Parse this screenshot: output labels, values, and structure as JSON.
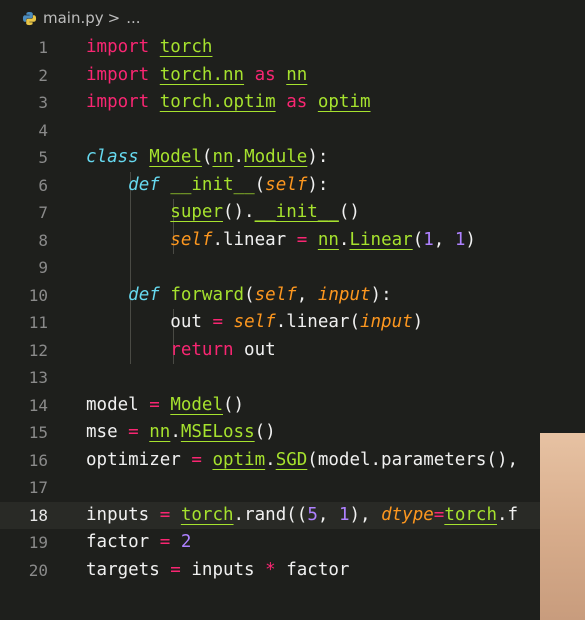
{
  "breadcrumb": {
    "file": "main.py",
    "separator": ">",
    "more": "..."
  },
  "lines": [
    {
      "num": "1",
      "tokens": [
        [
          "kw",
          "import"
        ],
        [
          "txt",
          " "
        ],
        [
          "name ul",
          "torch"
        ]
      ]
    },
    {
      "num": "2",
      "tokens": [
        [
          "kw",
          "import"
        ],
        [
          "txt",
          " "
        ],
        [
          "name ul",
          "torch.nn"
        ],
        [
          "txt",
          " "
        ],
        [
          "kw",
          "as"
        ],
        [
          "txt",
          " "
        ],
        [
          "name ul",
          "nn"
        ]
      ]
    },
    {
      "num": "3",
      "tokens": [
        [
          "kw",
          "import"
        ],
        [
          "txt",
          " "
        ],
        [
          "name ul",
          "torch.optim"
        ],
        [
          "txt",
          " "
        ],
        [
          "kw",
          "as"
        ],
        [
          "txt",
          " "
        ],
        [
          "name ul",
          "optim"
        ]
      ]
    },
    {
      "num": "4",
      "tokens": []
    },
    {
      "num": "5",
      "tokens": [
        [
          "cls",
          "class"
        ],
        [
          "txt",
          " "
        ],
        [
          "name ul",
          "Model"
        ],
        [
          "txt",
          "("
        ],
        [
          "name ul",
          "nn"
        ],
        [
          "txt",
          "."
        ],
        [
          "name ul",
          "Module"
        ],
        [
          "txt",
          "):"
        ]
      ]
    },
    {
      "num": "6",
      "guides": 1,
      "tokens": [
        [
          "txt",
          "    "
        ],
        [
          "cls",
          "def"
        ],
        [
          "txt",
          " "
        ],
        [
          "name",
          "__init__"
        ],
        [
          "txt",
          "("
        ],
        [
          "ital",
          "self"
        ],
        [
          "txt",
          "):"
        ]
      ]
    },
    {
      "num": "7",
      "guides": 2,
      "tokens": [
        [
          "txt",
          "        "
        ],
        [
          "name ul",
          "super"
        ],
        [
          "txt",
          "()."
        ],
        [
          "name ul",
          "__init__"
        ],
        [
          "txt",
          "()"
        ]
      ]
    },
    {
      "num": "8",
      "guides": 2,
      "tokens": [
        [
          "txt",
          "        "
        ],
        [
          "ital",
          "self"
        ],
        [
          "txt",
          ".linear "
        ],
        [
          "op",
          "="
        ],
        [
          "txt",
          " "
        ],
        [
          "name ul",
          "nn"
        ],
        [
          "txt",
          "."
        ],
        [
          "name ul",
          "Linear"
        ],
        [
          "txt",
          "("
        ],
        [
          "num",
          "1"
        ],
        [
          "txt",
          ", "
        ],
        [
          "num",
          "1"
        ],
        [
          "txt",
          ")"
        ]
      ]
    },
    {
      "num": "9",
      "guides": 1,
      "tokens": []
    },
    {
      "num": "10",
      "guides": 1,
      "tokens": [
        [
          "txt",
          "    "
        ],
        [
          "cls",
          "def"
        ],
        [
          "txt",
          " "
        ],
        [
          "name",
          "forward"
        ],
        [
          "txt",
          "("
        ],
        [
          "ital",
          "self"
        ],
        [
          "txt",
          ", "
        ],
        [
          "ital",
          "input"
        ],
        [
          "txt",
          "):"
        ]
      ]
    },
    {
      "num": "11",
      "guides": 2,
      "tokens": [
        [
          "txt",
          "        out "
        ],
        [
          "op",
          "="
        ],
        [
          "txt",
          " "
        ],
        [
          "ital",
          "self"
        ],
        [
          "txt",
          ".linear("
        ],
        [
          "ital",
          "input"
        ],
        [
          "txt",
          ")"
        ]
      ]
    },
    {
      "num": "12",
      "guides": 2,
      "tokens": [
        [
          "txt",
          "        "
        ],
        [
          "kw",
          "return"
        ],
        [
          "txt",
          " out"
        ]
      ]
    },
    {
      "num": "13",
      "tokens": []
    },
    {
      "num": "14",
      "tokens": [
        [
          "txt",
          "model "
        ],
        [
          "op",
          "="
        ],
        [
          "txt",
          " "
        ],
        [
          "name ul",
          "Model"
        ],
        [
          "txt",
          "()"
        ]
      ]
    },
    {
      "num": "15",
      "tokens": [
        [
          "txt",
          "mse "
        ],
        [
          "op",
          "="
        ],
        [
          "txt",
          " "
        ],
        [
          "name ul",
          "nn"
        ],
        [
          "txt",
          "."
        ],
        [
          "name ul",
          "MSELoss"
        ],
        [
          "txt",
          "()"
        ]
      ]
    },
    {
      "num": "16",
      "tokens": [
        [
          "txt",
          "optimizer "
        ],
        [
          "op",
          "="
        ],
        [
          "txt",
          " "
        ],
        [
          "name ul",
          "optim"
        ],
        [
          "txt",
          "."
        ],
        [
          "name ul",
          "SGD"
        ],
        [
          "txt",
          "(model.parameters(),"
        ]
      ]
    },
    {
      "num": "17",
      "tokens": []
    },
    {
      "num": "18",
      "current": true,
      "tokens": [
        [
          "txt",
          "inputs "
        ],
        [
          "op",
          "="
        ],
        [
          "txt",
          " "
        ],
        [
          "name ul",
          "torch"
        ],
        [
          "txt",
          ".rand(("
        ],
        [
          "num",
          "5"
        ],
        [
          "txt",
          ", "
        ],
        [
          "num",
          "1"
        ],
        [
          "txt",
          "), "
        ],
        [
          "ital",
          "dtype"
        ],
        [
          "op",
          "="
        ],
        [
          "name ul",
          "torch"
        ],
        [
          "txt",
          ".f"
        ]
      ]
    },
    {
      "num": "19",
      "tokens": [
        [
          "txt",
          "factor "
        ],
        [
          "op",
          "="
        ],
        [
          "txt",
          " "
        ],
        [
          "num",
          "2"
        ]
      ]
    },
    {
      "num": "20",
      "tokens": [
        [
          "txt",
          "targets "
        ],
        [
          "op",
          "="
        ],
        [
          "txt",
          " inputs "
        ],
        [
          "op",
          "*"
        ],
        [
          "txt",
          " factor"
        ]
      ]
    }
  ]
}
